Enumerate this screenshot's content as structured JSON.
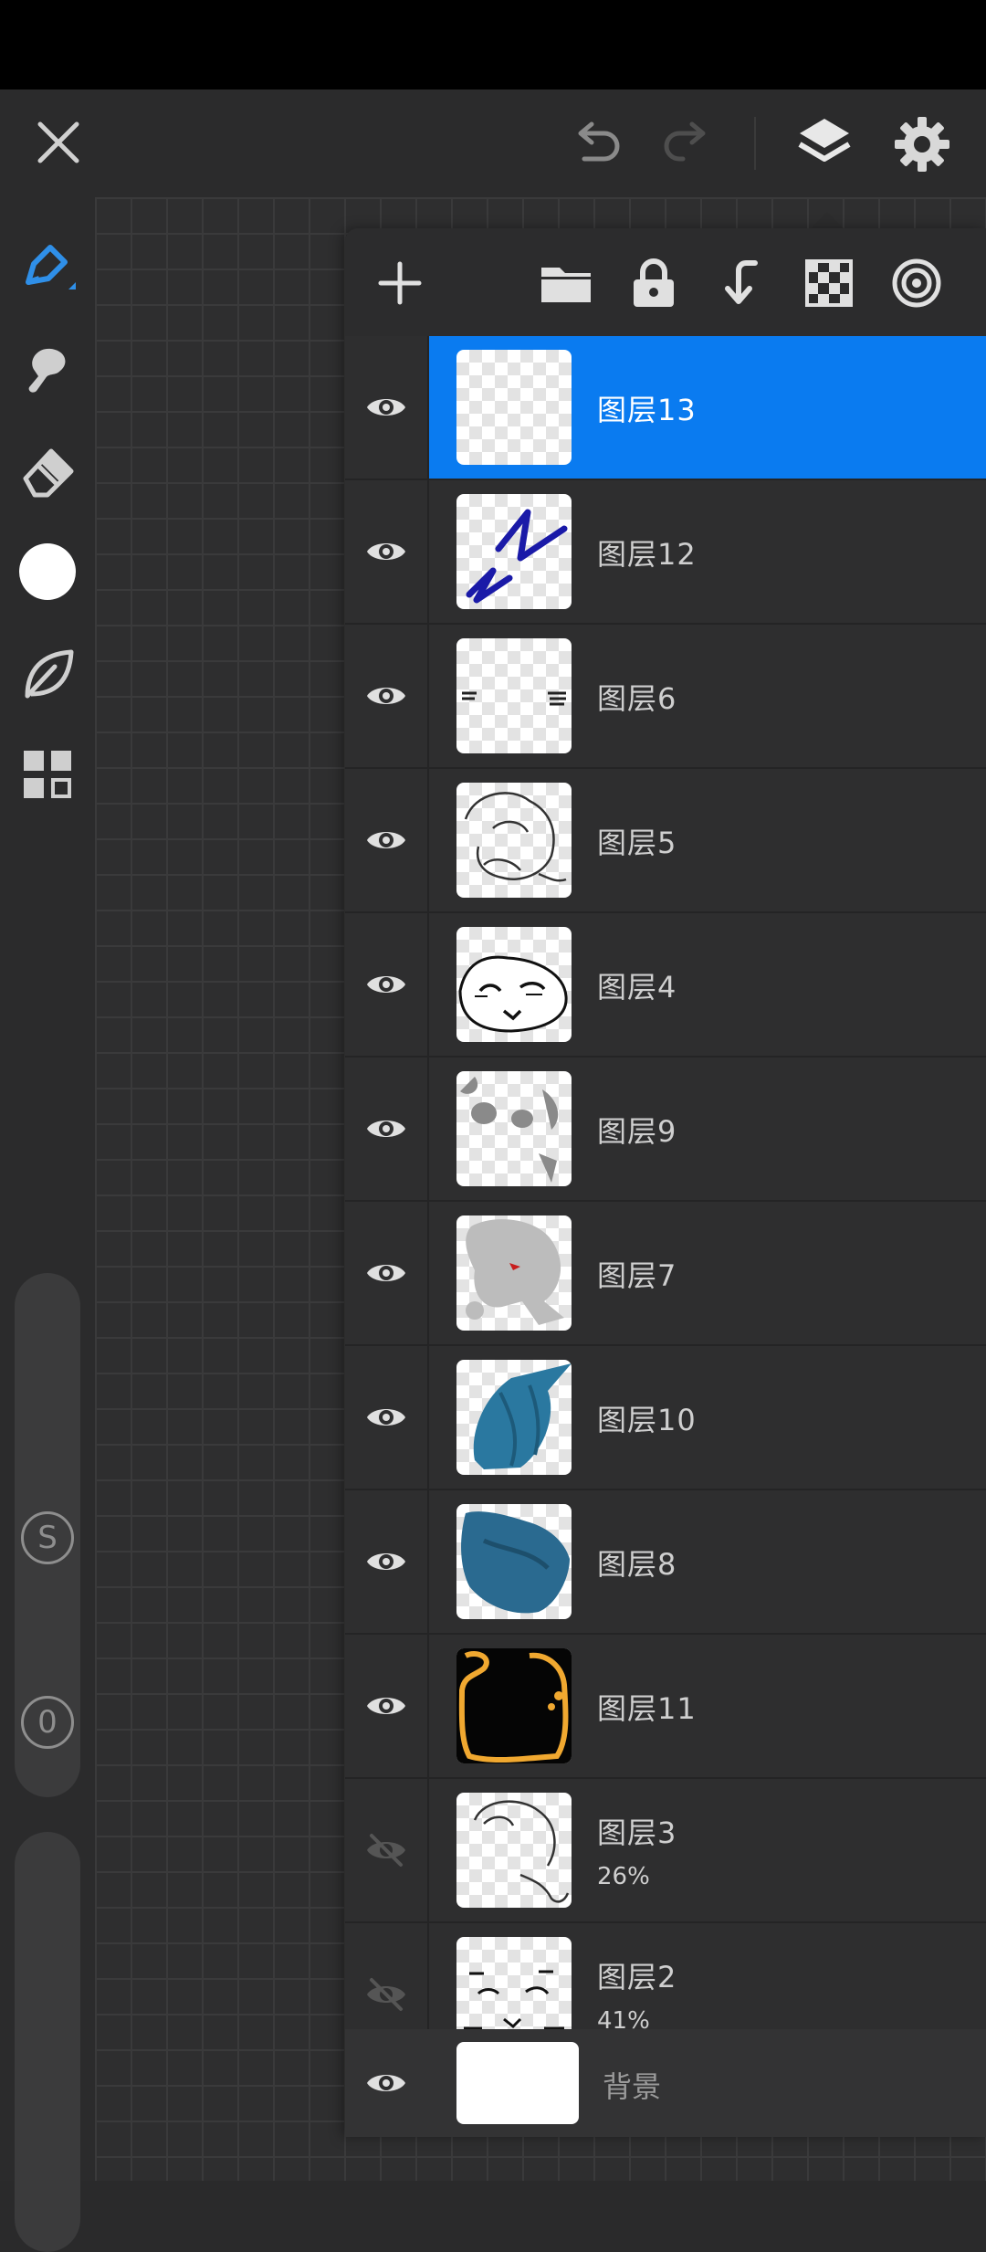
{
  "topbar": {
    "close_icon": "close-icon",
    "undo_icon": "undo-icon",
    "redo_icon": "redo-icon",
    "layers_icon": "layers-icon",
    "settings_icon": "gear-icon"
  },
  "toolbar": {
    "tools": [
      "pencil-icon",
      "smudge-icon",
      "eraser-icon",
      "color-icon",
      "leaf-icon",
      "grid-icon"
    ],
    "accent_color": "#2f8fe8",
    "size_label": "S",
    "opacity_label": "0"
  },
  "layers_panel": {
    "actions": [
      "add-icon",
      "folder-icon",
      "lock-icon",
      "merge-down-icon",
      "checker-icon",
      "target-icon"
    ],
    "selected_color": "#0a7bf0",
    "layers": [
      {
        "name": "图层13",
        "visible": true,
        "selected": true
      },
      {
        "name": "图层12",
        "visible": true
      },
      {
        "name": "图层6",
        "visible": true
      },
      {
        "name": "图层5",
        "visible": true
      },
      {
        "name": "图层4",
        "visible": true
      },
      {
        "name": "图层9",
        "visible": true
      },
      {
        "name": "图层7",
        "visible": true
      },
      {
        "name": "图层10",
        "visible": true
      },
      {
        "name": "图层8",
        "visible": true
      },
      {
        "name": "图层11",
        "visible": true
      },
      {
        "name": "图层3",
        "visible": false,
        "opacity": "26%"
      },
      {
        "name": "图层2",
        "visible": false,
        "opacity": "41%"
      }
    ],
    "background": {
      "name": "背景",
      "visible": true
    }
  }
}
